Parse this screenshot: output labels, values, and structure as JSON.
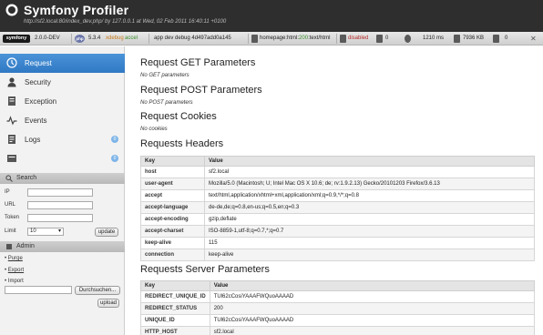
{
  "header": {
    "title": "Symfony Profiler",
    "token_info": "http://sf2.local:80/index_dev.php/ by 127.0.0.1 at Wed, 02 Feb 2011 16:40:11 +0100"
  },
  "toolbar": {
    "symfony_badge": "symfony",
    "symfony_version": "2.0.0-DEV",
    "php_badge": "php",
    "php_version": "5.3.4",
    "xdebug": "xdebug",
    "accel": "accel",
    "app_info": "app dev debug 4d497add0a145",
    "route_prefix": "homepage",
    "route_html": "html",
    "route_status": "200",
    "route_mime": "text/html",
    "disabled": "disabled",
    "count_a": "0",
    "time": "1210 ms",
    "memory": "7936 KB",
    "count_b": "0"
  },
  "sidebar": {
    "nav": [
      {
        "label": "Request",
        "icon": "request-icon",
        "active": true,
        "count": ""
      },
      {
        "label": "Security",
        "icon": "security-icon",
        "active": false,
        "count": ""
      },
      {
        "label": "Exception",
        "icon": "exception-icon",
        "active": false,
        "count": ""
      },
      {
        "label": "Events",
        "icon": "events-icon",
        "active": false,
        "count": ""
      },
      {
        "label": "Logs",
        "icon": "logs-icon",
        "active": false,
        "count": "0"
      },
      {
        "label": "",
        "icon": "timeline-icon",
        "active": false,
        "count": "0"
      }
    ],
    "search": {
      "title": "Search",
      "ip_label": "IP",
      "url_label": "URL",
      "token_label": "Token",
      "limit_label": "Limit",
      "limit_value": "10",
      "button": "update"
    },
    "admin": {
      "title": "Admin",
      "purge": "Purge",
      "export": "Export",
      "import": "Import",
      "browse_button": "Durchsuchen...",
      "upload_button": "upload"
    }
  },
  "main": {
    "get_title": "Request GET Parameters",
    "get_note": "No GET parameters",
    "post_title": "Request POST Parameters",
    "post_note": "No POST parameters",
    "cookies_title": "Request Cookies",
    "cookies_note": "No cookies",
    "headers_title": "Requests Headers",
    "headers_columns": [
      "Key",
      "Value"
    ],
    "headers": [
      [
        "host",
        "sf2.local"
      ],
      [
        "user-agent",
        "Mozilla/5.0 (Macintosh; U; Intel Mac OS X 10.6; de; rv:1.9.2.13) Gecko/20101203 Firefox/3.6.13"
      ],
      [
        "accept",
        "text/html,application/xhtml+xml,application/xml;q=0.9,*/*;q=0.8"
      ],
      [
        "accept-language",
        "de-de,de;q=0.8,en-us;q=0.5,en;q=0.3"
      ],
      [
        "accept-encoding",
        "gzip,deflate"
      ],
      [
        "accept-charset",
        "ISO-8859-1,utf-8;q=0.7,*;q=0.7"
      ],
      [
        "keep-alive",
        "115"
      ],
      [
        "connection",
        "keep-alive"
      ]
    ],
    "server_title": "Requests Server Parameters",
    "server_columns": [
      "Key",
      "Value"
    ],
    "server": [
      [
        "REDIRECT_UNIQUE_ID",
        "TUl62cCosiYAAAFWQuoAAAAD"
      ],
      [
        "REDIRECT_STATUS",
        "200"
      ],
      [
        "UNIQUE_ID",
        "TUl62cCosiYAAAFWQuoAAAAD"
      ],
      [
        "HTTP_HOST",
        "sf2.local"
      ]
    ]
  }
}
